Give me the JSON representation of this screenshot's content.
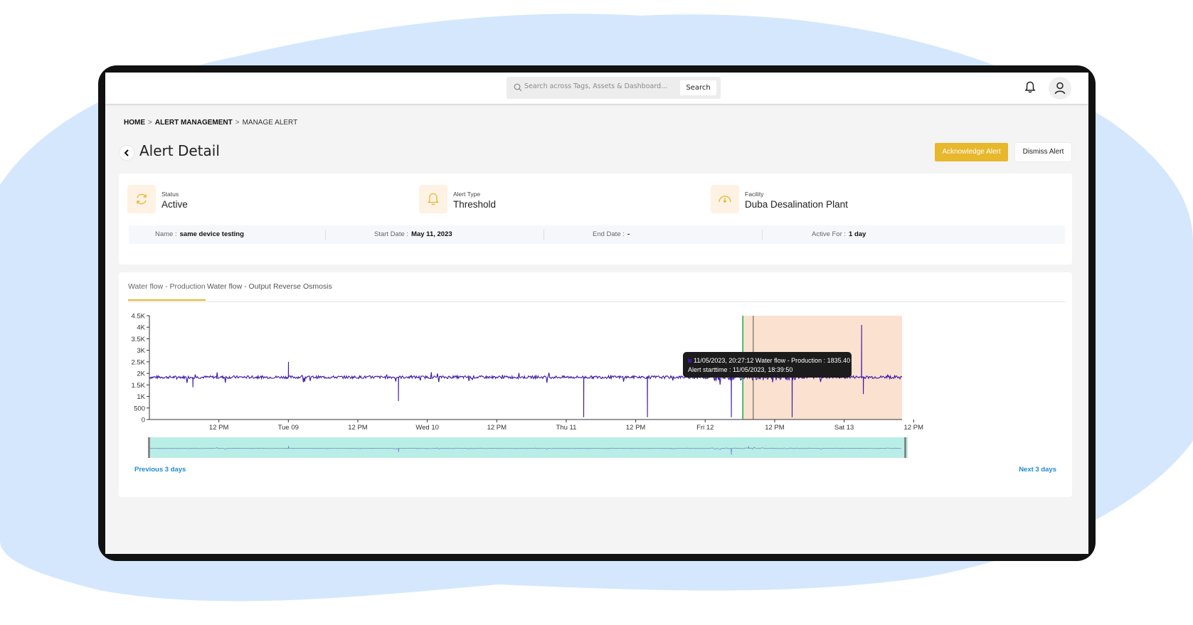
{
  "header": {
    "search_placeholder": "Search across Tags, Assets & Dashboard...",
    "search_button": "Search"
  },
  "breadcrumb": {
    "home": "HOME",
    "sep": ">",
    "section": "ALERT MANAGEMENT",
    "current": "MANAGE ALERT"
  },
  "page": {
    "title": "Alert Detail",
    "acknowledge_label": "Acknowledge Alert",
    "dismiss_label": "Dismiss Alert"
  },
  "summary": {
    "status_label": "Status",
    "status_value": "Active",
    "alert_type_label": "Alert Type",
    "alert_type_value": "Threshold",
    "facility_label": "Facility",
    "facility_value": "Duba Desalination Plant"
  },
  "info": {
    "name_key": "Name :",
    "name_value": "same device testing",
    "start_key": "Start Date :",
    "start_value": "May 11, 2023",
    "end_key": "End Date :",
    "end_value": "-",
    "active_key": "Active For :",
    "active_value": "1 day"
  },
  "tabs": [
    "Water flow - Production",
    "Water flow - Output Reverse Osmosis"
  ],
  "chart_nav": {
    "prev": "Previous 3 days",
    "next": "Next 3 days"
  },
  "colors": {
    "accent": "#e7b72c",
    "series": "#3d17a8",
    "alert_region": "#fbe1cf",
    "navigator": "#b9eee6",
    "link": "#1f8bd1"
  },
  "chart_data": {
    "type": "line",
    "series": [
      {
        "name": "Water flow - Production",
        "baseline": 1835,
        "values_summary": "approximately 1800-1900 throughout, with downward spikes to ~0-200 and upward spikes to ~2500-4000"
      }
    ],
    "y_ticks": [
      "0",
      "500",
      "1K",
      "1.5K",
      "2K",
      "2.5K",
      "3K",
      "3.5K",
      "4K",
      "4.5K"
    ],
    "ylim": [
      0,
      4500
    ],
    "x_ticks": [
      "12 PM",
      "Tue 09",
      "12 PM",
      "Wed 10",
      "12 PM",
      "Thu 11",
      "12 PM",
      "Fri 12",
      "12 PM",
      "Sat 13",
      "12 PM"
    ],
    "xlim_hours": [
      0,
      130
    ],
    "spikes": [
      {
        "t": 7.5,
        "v": 1400
      },
      {
        "t": 24,
        "v": 2500
      },
      {
        "t": 43,
        "v": 800
      },
      {
        "t": 75,
        "v": 100
      },
      {
        "t": 86,
        "v": 100
      },
      {
        "t": 96.5,
        "v": 2600
      },
      {
        "t": 100.5,
        "v": 100
      },
      {
        "t": 103.5,
        "v": 2400
      },
      {
        "t": 111,
        "v": 100
      },
      {
        "t": 123,
        "v": 4100
      },
      {
        "t": 123.3,
        "v": 1100
      }
    ],
    "alert_region_hours": [
      102.5,
      130
    ],
    "alert_start_hour": 102.5,
    "cursor_hour": 104.3,
    "tooltip": {
      "line1": "11/05/2023, 20:27:12 Water flow - Production : 1835.40",
      "line2": "Alert starttime : 11/05/2023, 18:39:50"
    },
    "grid": false,
    "legend": "none"
  }
}
